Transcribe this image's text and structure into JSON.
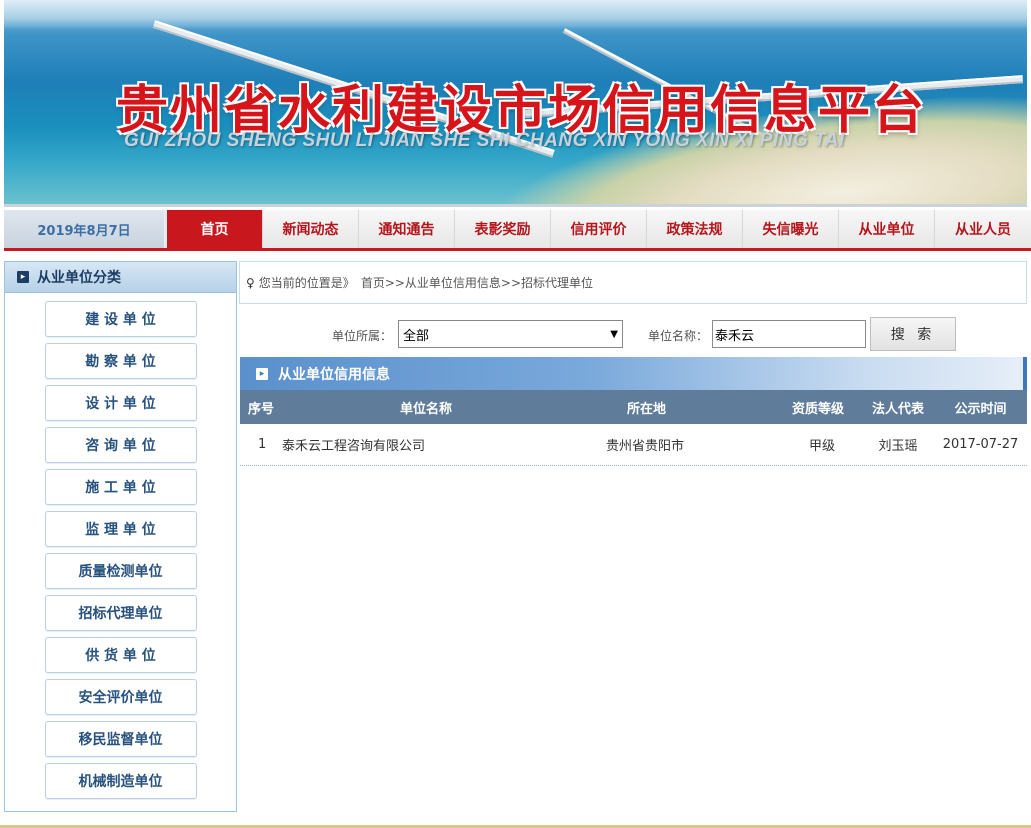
{
  "header": {
    "title": "贵州省水利建设市场信用信息平台",
    "subtitle": "GUI ZHOU SHENG SHUI LI JIAN SHE SHI CHANG XIN YONG XIN XI PING TAI"
  },
  "nav": {
    "date": "2019年8月7日",
    "items": [
      "首页",
      "新闻动态",
      "通知通告",
      "表影奖励",
      "信用评价",
      "政策法规",
      "失信曝光",
      "从业单位",
      "从业人员"
    ],
    "active_index": 0
  },
  "sidebar": {
    "title": "从业单位分类",
    "items": [
      "建 设 单 位",
      "勘 察 单 位",
      "设 计 单 位",
      "咨 询 单 位",
      "施 工 单 位",
      "监 理 单 位",
      "质量检测单位",
      "招标代理单位",
      "供 货 单 位",
      "安全评价单位",
      "移民监督单位",
      "机械制造单位"
    ]
  },
  "breadcrumb": {
    "prefix": "您当前的位置是》",
    "path": "首页>>从业单位信用信息>>招标代理单位"
  },
  "search": {
    "unit_belong_label": "单位所属：",
    "unit_belong_value": "全部",
    "unit_name_label": "单位名称：",
    "unit_name_value": "泰禾云",
    "button_label": "搜 索"
  },
  "panel": {
    "title": "从业单位信用信息",
    "columns": [
      "序号",
      "单位名称",
      "所在地",
      "资质等级",
      "法人代表",
      "公示时间"
    ],
    "rows": [
      [
        "1",
        "泰禾云工程咨询有限公司",
        "贵州省贵阳市",
        "甲级",
        "刘玉瑶",
        "2017-07-27"
      ]
    ]
  },
  "colors": {
    "brand_red": "#c8181e",
    "nav_text": "#b5151b",
    "table_header": "#5f7d9a",
    "panel_header": "#5a90cc"
  }
}
